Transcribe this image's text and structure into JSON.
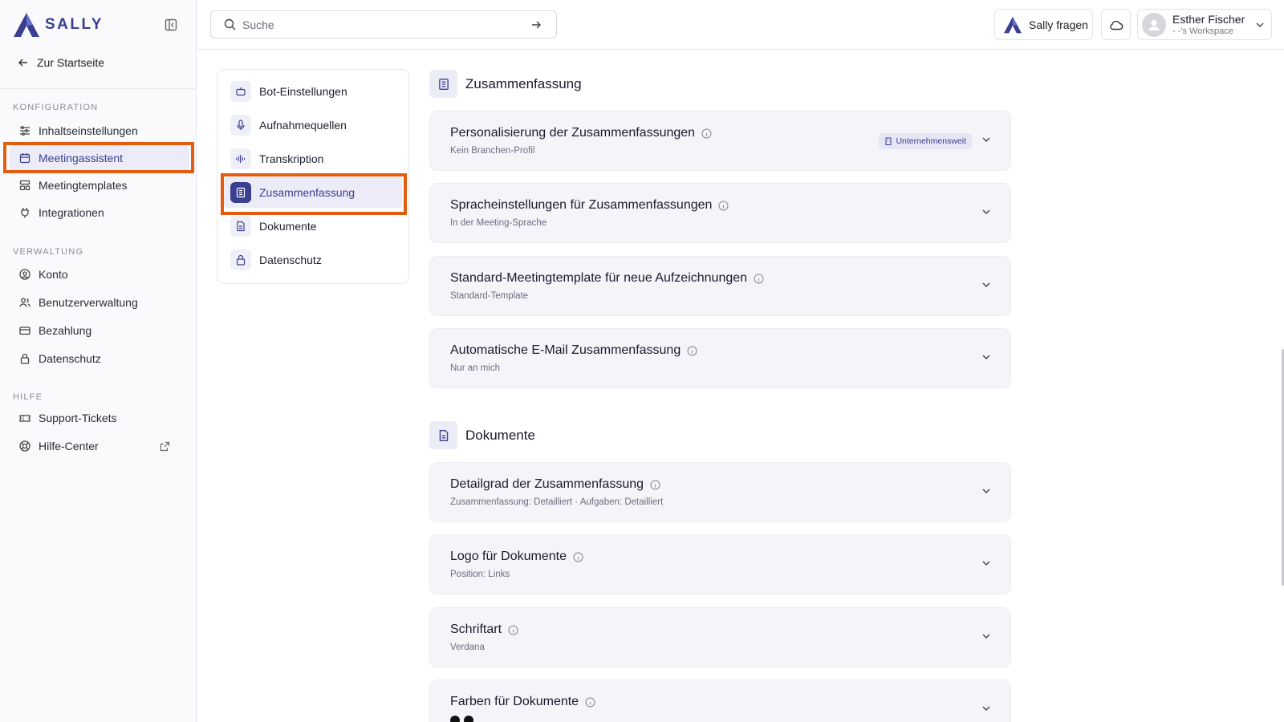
{
  "brand": {
    "name": "SALLY",
    "color": "#3b3f8f"
  },
  "sidebar": {
    "back_label": "Zur Startseite",
    "sections": [
      {
        "label": "KONFIGURATION",
        "items": [
          {
            "label": "Inhaltseinstellungen",
            "icon": "sliders-icon"
          },
          {
            "label": "Meetingassistent",
            "icon": "calendar-icon",
            "active": true
          },
          {
            "label": "Meetingtemplates",
            "icon": "template-icon"
          },
          {
            "label": "Integrationen",
            "icon": "plug-icon"
          }
        ]
      },
      {
        "label": "VERWALTUNG",
        "items": [
          {
            "label": "Konto",
            "icon": "account-icon"
          },
          {
            "label": "Benutzerverwaltung",
            "icon": "users-icon"
          },
          {
            "label": "Bezahlung",
            "icon": "credit-card-icon"
          },
          {
            "label": "Datenschutz",
            "icon": "lock-icon"
          }
        ]
      },
      {
        "label": "HILFE",
        "items": [
          {
            "label": "Support-Tickets",
            "icon": "ticket-icon"
          },
          {
            "label": "Hilfe-Center",
            "icon": "lifebuoy-icon",
            "external": true
          }
        ]
      }
    ]
  },
  "topbar": {
    "search_placeholder": "Suche",
    "ask_label": "Sally fragen",
    "user_name": "Esther Fischer",
    "workspace": "- -'s Workspace"
  },
  "subnav": {
    "items": [
      {
        "label": "Bot-Einstellungen",
        "icon": "bot-icon"
      },
      {
        "label": "Aufnahmequellen",
        "icon": "microphone-icon"
      },
      {
        "label": "Transkription",
        "icon": "waveform-icon"
      },
      {
        "label": "Zusammenfassung",
        "icon": "summary-icon",
        "active": true
      },
      {
        "label": "Dokumente",
        "icon": "document-icon"
      },
      {
        "label": "Datenschutz",
        "icon": "lock-icon"
      }
    ]
  },
  "main": {
    "sections": [
      {
        "title": "Zusammenfassung",
        "icon": "summary-icon",
        "cards": [
          {
            "title": "Personalisierung der Zusammenfassungen",
            "subtitle": "Kein Branchen-Profil",
            "badge": "Unternehmensweit"
          },
          {
            "title": "Spracheinstellungen für Zusammenfassungen",
            "subtitle": "In der Meeting-Sprache"
          },
          {
            "title": "Standard-Meetingtemplate für neue Aufzeichnungen",
            "subtitle": "Standard-Template"
          },
          {
            "title": "Automatische E-Mail Zusammenfassung",
            "subtitle": "Nur an mich"
          }
        ]
      },
      {
        "title": "Dokumente",
        "icon": "document-icon",
        "cards": [
          {
            "title": "Detailgrad der Zusammenfassung",
            "subtitle": "Zusammenfassung: Detailliert · Aufgaben: Detailliert"
          },
          {
            "title": "Logo für Dokumente",
            "subtitle": "Position: Links"
          },
          {
            "title": "Schriftart",
            "subtitle": "Verdana"
          },
          {
            "title": "Farben für Dokumente",
            "subtitle": "",
            "colors": [
              "#111111",
              "#111111"
            ]
          }
        ]
      }
    ]
  },
  "colors": {
    "accent": "#3b3f8f",
    "highlight": "#e35d10",
    "active_bg": "#ecebf8"
  }
}
